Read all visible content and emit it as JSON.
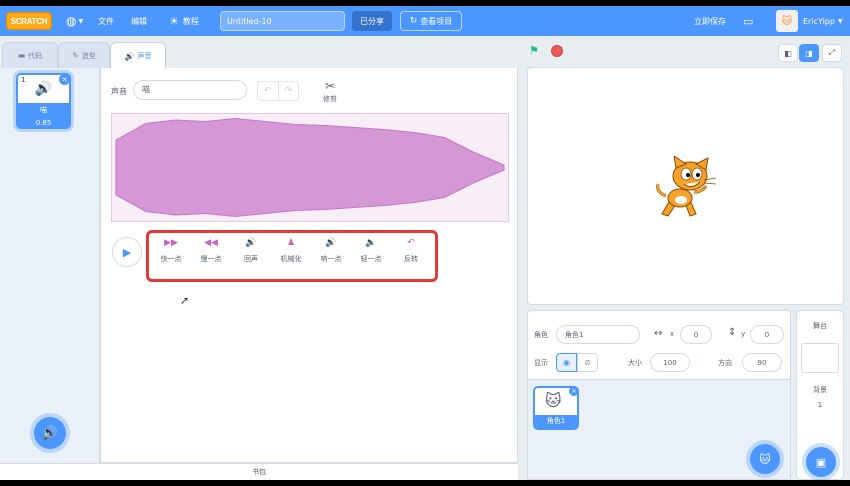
{
  "menubar": {
    "logo": "SCRATCH",
    "file": "文件",
    "edit": "编辑",
    "tutorials": "教程",
    "project_title": "Untitled-10",
    "share": "已分享",
    "see_project": "查看项目",
    "save_now": "立即保存",
    "username": "EricYipp"
  },
  "tabs": {
    "code": "代码",
    "costumes": "造型",
    "sounds": "声音"
  },
  "sound_list": {
    "items": [
      {
        "index": "1",
        "name": "喵",
        "duration": "0.85"
      }
    ]
  },
  "editor": {
    "sound_label": "声音",
    "sound_name": "喵",
    "trim_label": "修剪",
    "effects": [
      {
        "label": "快一点",
        "icon": "▶▶"
      },
      {
        "label": "慢一点",
        "icon": "◀◀"
      },
      {
        "label": "回声",
        "icon": "🔊"
      },
      {
        "label": "机械化",
        "icon": "♟"
      },
      {
        "label": "响一点",
        "icon": "🔊"
      },
      {
        "label": "轻一点",
        "icon": "🔈"
      },
      {
        "label": "反转",
        "icon": "↶"
      }
    ]
  },
  "waveform": {
    "amplitude_envelope": [
      0.55,
      0.88,
      0.95,
      0.92,
      0.98,
      0.92,
      0.86,
      0.84,
      0.8,
      0.76,
      0.7,
      0.6,
      0.3,
      0.05
    ]
  },
  "backpack": "书包",
  "sprite_info": {
    "sprite_label": "角色",
    "sprite_name": "角色1",
    "x_label": "x",
    "x_value": "0",
    "y_label": "y",
    "y_value": "0",
    "show_label": "显示",
    "size_label": "大小",
    "size_value": "100",
    "direction_label": "方向",
    "direction_value": "90"
  },
  "sprites": [
    {
      "name": "角色1"
    }
  ],
  "stage_pane": {
    "title": "舞台",
    "backdrops_label": "背景",
    "backdrops_count": "1"
  },
  "colors": {
    "accent": "#4c97ff",
    "sound_wave": "#cf63cf",
    "highlight": "#e53935"
  }
}
